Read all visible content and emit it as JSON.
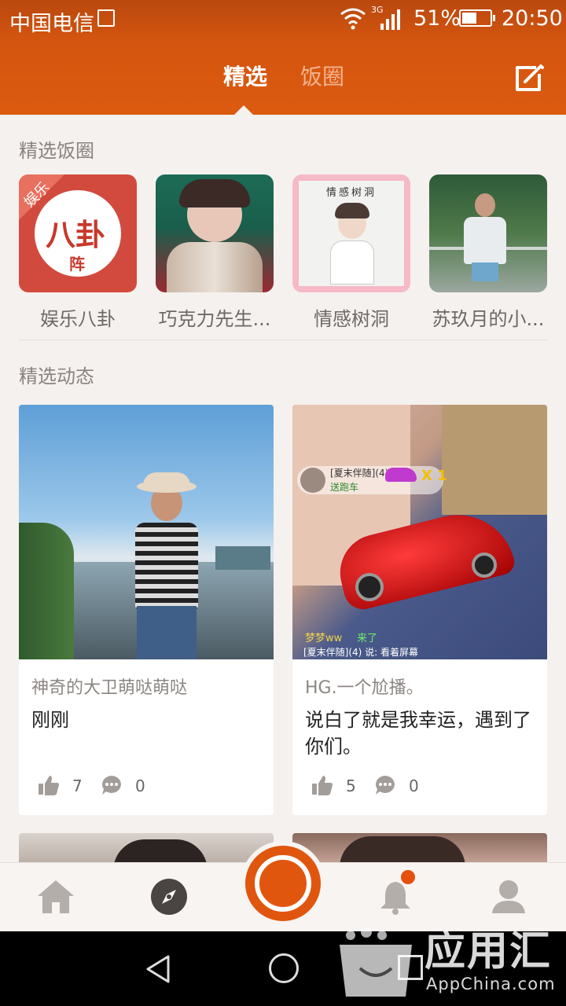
{
  "status_bar": {
    "carrier": "中国电信",
    "network": "3G",
    "battery": "51%",
    "time": "20:50"
  },
  "tabs": [
    {
      "label": "精选",
      "active": true
    },
    {
      "label": "饭圈",
      "active": false
    }
  ],
  "featured_circles": {
    "title": "精选饭圈",
    "items": [
      {
        "name": "娱乐八卦",
        "badge": "娱乐",
        "logo_text": "八卦",
        "logo_sub": "阵"
      },
      {
        "name": "巧克力先生..."
      },
      {
        "name": "情感树洞",
        "banner": "情感树洞"
      },
      {
        "name": "苏玖月的小..."
      }
    ]
  },
  "featured_posts": {
    "title": "精选动态",
    "items": [
      {
        "author": "神奇的大卫萌哒萌哒",
        "text": "刚刚",
        "likes": "7",
        "comments": "0"
      },
      {
        "author": "HG.一个尬播。",
        "text": "说白了就是我幸运，遇到了你们。",
        "likes": "5",
        "comments": "0",
        "overlay": {
          "user": "[夏末伴随](4)",
          "gift": "送跑车",
          "multiplier": "X 1",
          "chat1_name": "梦梦ww",
          "chat1_msg": "来了",
          "chat2": "[夏末伴随](4) 说: 看着屏幕"
        }
      }
    ]
  },
  "bottom_nav": [
    {
      "name": "home"
    },
    {
      "name": "discover"
    },
    {
      "name": "record"
    },
    {
      "name": "notifications",
      "has_badge": true
    },
    {
      "name": "profile"
    }
  ],
  "watermark": {
    "title": "应用汇",
    "subtitle": "AppChina.com"
  },
  "colors": {
    "brand": "#dc5a10",
    "background": "#f5f1ee"
  }
}
